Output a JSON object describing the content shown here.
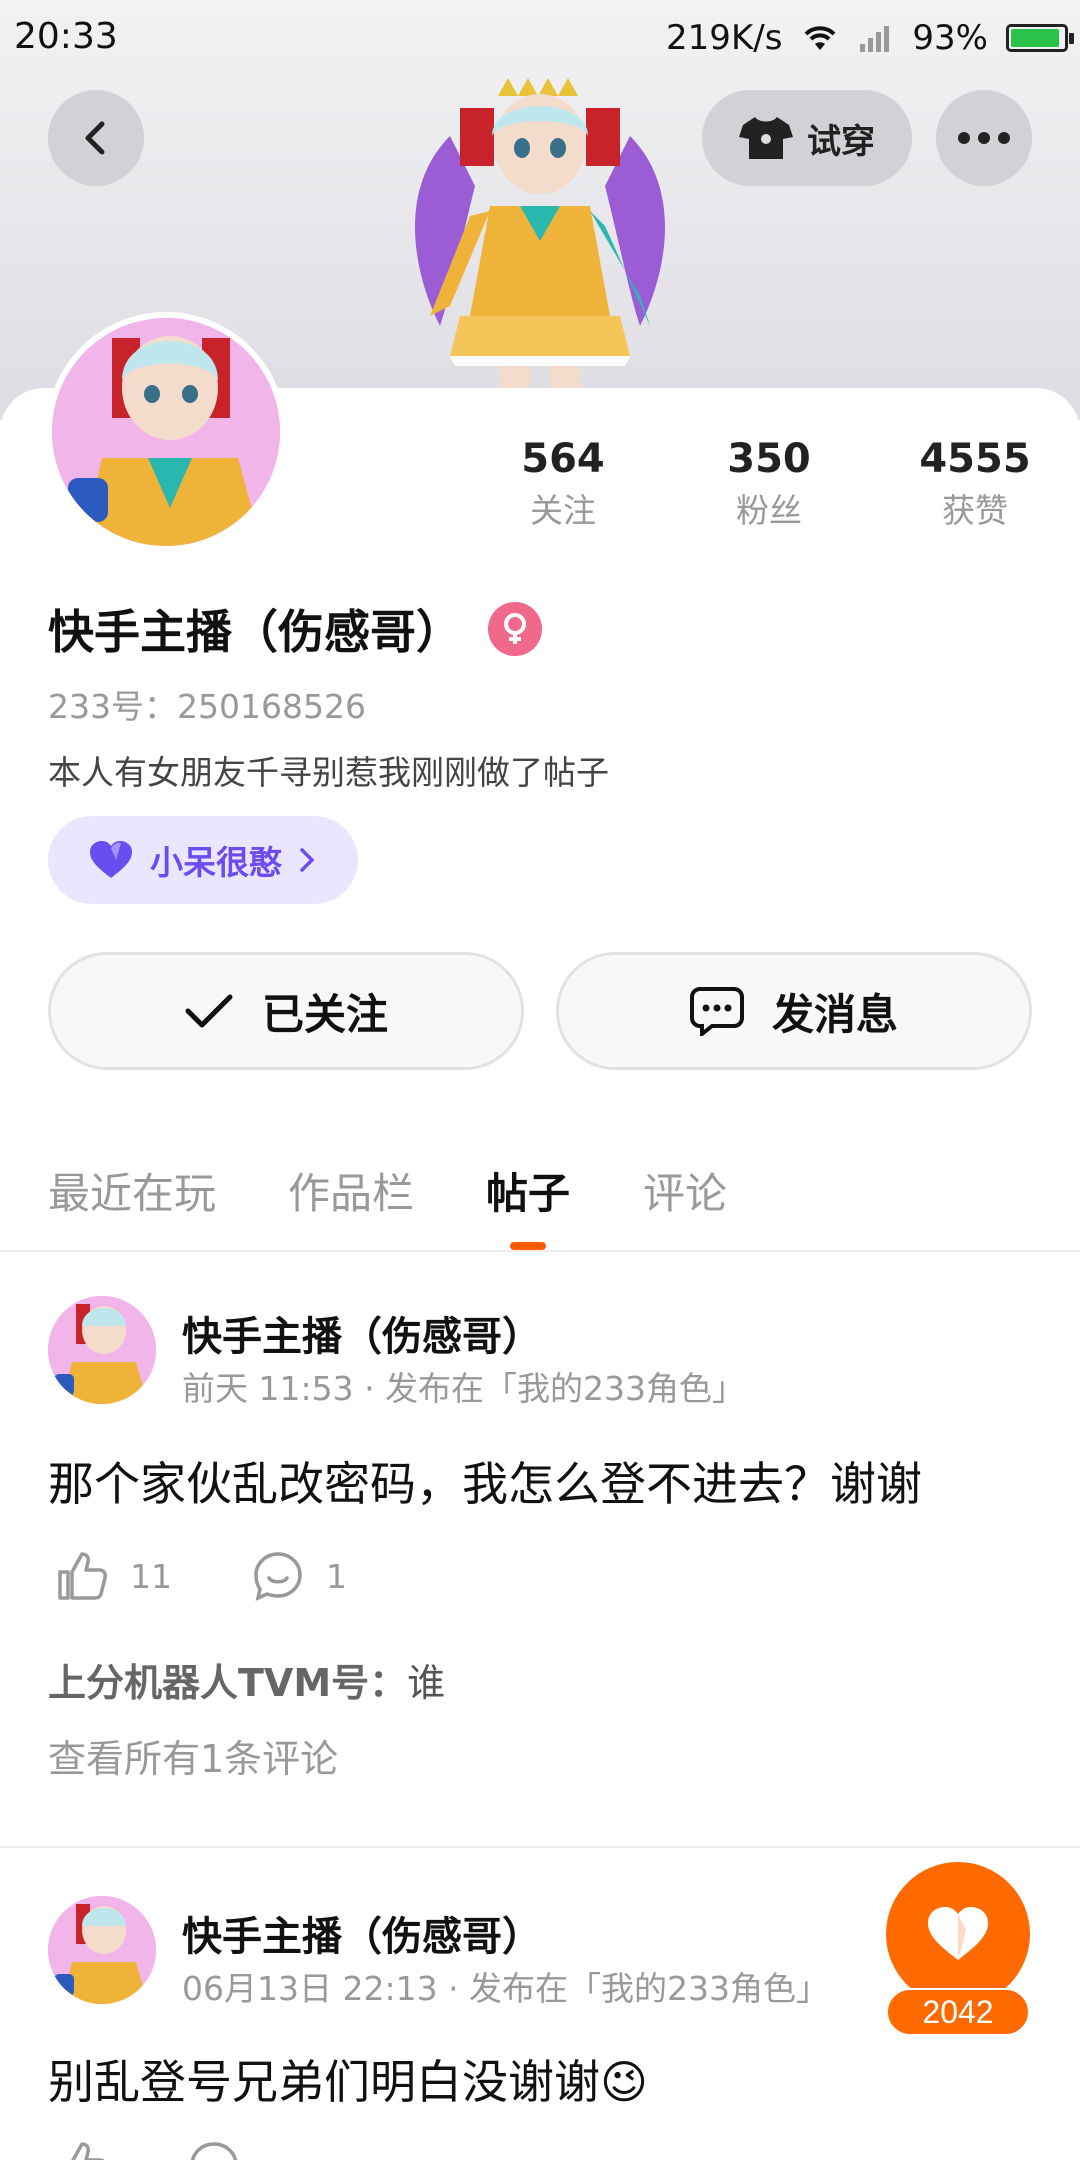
{
  "status_bar": {
    "time": "20:33",
    "net_speed": "219K/s",
    "battery": "93%",
    "battery_level": 0.93
  },
  "header": {
    "tryon_label": "试穿"
  },
  "profile": {
    "stats": [
      {
        "value": "564",
        "label": "关注"
      },
      {
        "value": "350",
        "label": "粉丝"
      },
      {
        "value": "4555",
        "label": "获赞"
      }
    ],
    "name": "快手主播（伤感哥）",
    "uid": "233号：250168526",
    "bio": "本人有女朋友千寻别惹我刚刚做了帖子",
    "tag": "小呆很憨",
    "follow_label": "已关注",
    "message_label": "发消息"
  },
  "tabs": [
    {
      "label": "最近在玩",
      "active": false
    },
    {
      "label": "作品栏",
      "active": false
    },
    {
      "label": "帖子",
      "active": true
    },
    {
      "label": "评论",
      "active": false
    }
  ],
  "posts": [
    {
      "author": "快手主播（伤感哥）",
      "meta": "前天 11:53 · 发布在「我的233角色」",
      "text": "那个家伙乱改密码，我怎么登不进去？谢谢",
      "likes": "11",
      "comments": "1",
      "comment_author": "上分机器人TVM号：",
      "comment_text": "谁",
      "view_all": "查看所有1条评论"
    },
    {
      "author": "快手主播（伤感哥）",
      "meta": "06月13日 22:13 · 发布在「我的233角色」",
      "text": "别乱登号兄弟们明白没谢谢",
      "emoji": "😉"
    }
  ],
  "float_like": {
    "count": "2042"
  },
  "colors": {
    "accent": "#ff6a00",
    "tab_indicator": "#ff5b00",
    "tag_bg": "#ebe6ff",
    "tag_text": "#6a4df0",
    "gender_badge": "#f0698a"
  },
  "icons": [
    "back-arrow-icon",
    "tshirt-icon",
    "more-dots-icon",
    "venus-icon",
    "heart-icon",
    "chevron-right-icon",
    "check-icon",
    "chat-bubble-icon",
    "thumb-up-icon",
    "comment-icon",
    "wifi-icon",
    "signal-icon",
    "battery-icon"
  ]
}
